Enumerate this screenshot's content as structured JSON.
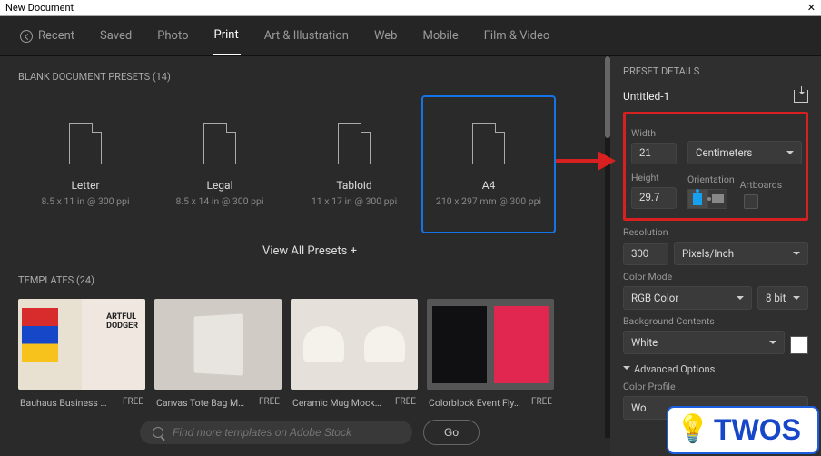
{
  "window": {
    "title": "New Document",
    "close": "✕"
  },
  "nav": {
    "recent": "Recent",
    "saved": "Saved",
    "photo": "Photo",
    "print": "Print",
    "art": "Art & Illustration",
    "web": "Web",
    "mobile": "Mobile",
    "film": "Film & Video"
  },
  "presets": {
    "heading": "BLANK DOCUMENT PRESETS (14)",
    "items": [
      {
        "name": "Letter",
        "dim": "8.5 x 11 in @ 300 ppi"
      },
      {
        "name": "Legal",
        "dim": "8.5 x 14 in @ 300 ppi"
      },
      {
        "name": "Tabloid",
        "dim": "11 x 17 in @ 300 ppi"
      },
      {
        "name": "A4",
        "dim": "210 x 297 mm @ 300 ppi"
      }
    ],
    "view_all": "View All Presets +"
  },
  "templates": {
    "heading": "TEMPLATES (24)",
    "items": [
      {
        "name": "Bauhaus Business Ca…",
        "price": "FREE"
      },
      {
        "name": "Canvas Tote Bag Mo…",
        "price": "FREE"
      },
      {
        "name": "Ceramic Mug Mockup…",
        "price": "FREE"
      },
      {
        "name": "Colorblock Event Fly…",
        "price": "FREE"
      }
    ]
  },
  "search": {
    "placeholder": "Find more templates on Adobe Stock",
    "go": "Go"
  },
  "details": {
    "heading": "PRESET DETAILS",
    "doc_name": "Untitled-1",
    "width_label": "Width",
    "width_value": "21",
    "units": "Centimeters",
    "height_label": "Height",
    "height_value": "29.7",
    "orientation_label": "Orientation",
    "artboards_label": "Artboards",
    "resolution_label": "Resolution",
    "resolution_value": "300",
    "resolution_units": "Pixels/Inch",
    "color_mode_label": "Color Mode",
    "color_mode": "RGB Color",
    "bit_depth": "8 bit",
    "bg_label": "Background Contents",
    "bg_value": "White",
    "advanced": "Advanced Options",
    "profile_label": "Color Profile",
    "profile_value": "Wo"
  },
  "overlay": {
    "brand": "TWOS"
  }
}
